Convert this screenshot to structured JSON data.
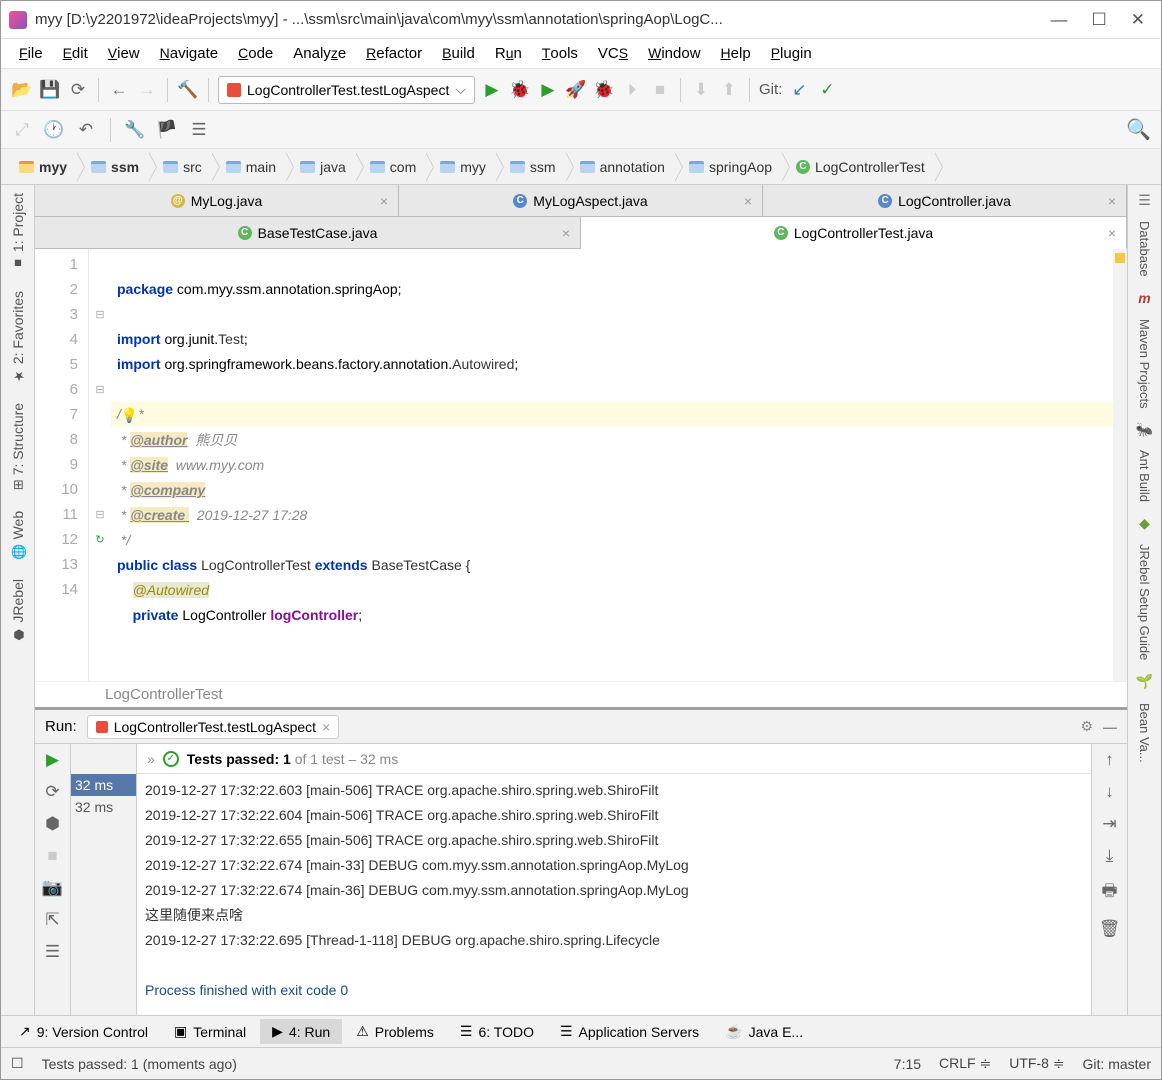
{
  "window": {
    "title": "myy [D:\\y2201972\\ideaProjects\\myy] - ...\\ssm\\src\\main\\java\\com\\myy\\ssm\\annotation\\springAop\\LogC...",
    "minimize": "—",
    "maximize": "☐",
    "close": "✕"
  },
  "menu": [
    "File",
    "Edit",
    "View",
    "Navigate",
    "Code",
    "Analyze",
    "Refactor",
    "Build",
    "Run",
    "Tools",
    "VCS",
    "Window",
    "Help",
    "Plugin"
  ],
  "run_config": "LogControllerTest.testLogAspect",
  "git_label": "Git:",
  "breadcrumb": [
    "myy",
    "ssm",
    "src",
    "main",
    "java",
    "com",
    "myy",
    "ssm",
    "annotation",
    "springAop",
    "LogControllerTest"
  ],
  "tabs_row1": [
    {
      "icon": "a",
      "label": "MyLog.java"
    },
    {
      "icon": "c",
      "label": "MyLogAspect.java"
    },
    {
      "icon": "c",
      "label": "LogController.java"
    }
  ],
  "tabs_row2": [
    {
      "icon": "g",
      "label": "BaseTestCase.java",
      "active": false
    },
    {
      "icon": "g",
      "label": "LogControllerTest.java",
      "active": true
    }
  ],
  "code": {
    "line1_kw": "package",
    "line1_rest": " com.myy.ssm.annotation.springAop;",
    "line3_kw": "import",
    "line3_rest": " org.junit.",
    "line3_cls": "Test",
    "line3_end": ";",
    "line4_kw": "import",
    "line4_rest": " org.springframework.beans.factory.annotation.",
    "line4_cls": "Autowired",
    "line4_end": ";",
    "line6": "/**",
    "line7_pre": " * ",
    "line7_tag": "@author",
    "line7_txt": "  熊贝贝",
    "line8_pre": " * ",
    "line8_tag": "@site",
    "line8_txt": "  www.myy.com",
    "line9_pre": " * ",
    "line9_tag": "@company",
    "line10_pre": " * ",
    "line10_tag": "@create ",
    "line10_txt": "  2019-12-27 17:28",
    "line11": " */",
    "line12_kw1": "public",
    "line12_kw2": "class",
    "line12_cls": "LogControllerTest",
    "line12_kw3": "extends",
    "line12_base": "BaseTestCase {",
    "line13_ann": "@Autowired",
    "line14_kw": "private",
    "line14_type": "LogController",
    "line14_fld": "logController",
    "line14_end": ";"
  },
  "breadcrumb2": "LogControllerTest",
  "left_tabs": [
    "1: Project",
    "2: Favorites",
    "7: Structure",
    "Web",
    "JRebel"
  ],
  "right_tabs": [
    "Database",
    "Maven Projects",
    "Ant Build",
    "JRebel Setup Guide",
    "Bean Va..."
  ],
  "run": {
    "label": "Run:",
    "config": "LogControllerTest.testLogAspect",
    "tests_passed": "Tests passed: 1",
    "tests_rest": " of 1 test – 32 ms",
    "tree": [
      "32 ms",
      "32 ms"
    ],
    "lines": [
      "2019-12-27 17:32:22.603 [main-506] TRACE org.apache.shiro.spring.web.ShiroFilt",
      "2019-12-27 17:32:22.604 [main-506] TRACE org.apache.shiro.spring.web.ShiroFilt",
      "2019-12-27 17:32:22.655 [main-506] TRACE org.apache.shiro.spring.web.ShiroFilt",
      "2019-12-27 17:32:22.674 [main-33] DEBUG com.myy.ssm.annotation.springAop.MyLog",
      "2019-12-27 17:32:22.674 [main-36] DEBUG com.myy.ssm.annotation.springAop.MyLog",
      "这里随便来点啥",
      "2019-12-27 17:32:22.695 [Thread-1-118] DEBUG org.apache.shiro.spring.Lifecycle",
      "",
      "Process finished with exit code 0"
    ]
  },
  "bottom_tabs": [
    "9: Version Control",
    "Terminal",
    "4: Run",
    "Problems",
    "6: TODO",
    "Application Servers",
    "Java E..."
  ],
  "status": {
    "msg": "Tests passed: 1 (moments ago)",
    "pos": "7:15",
    "eol": "CRLF",
    "enc": "UTF-8",
    "git": "Git: master"
  }
}
